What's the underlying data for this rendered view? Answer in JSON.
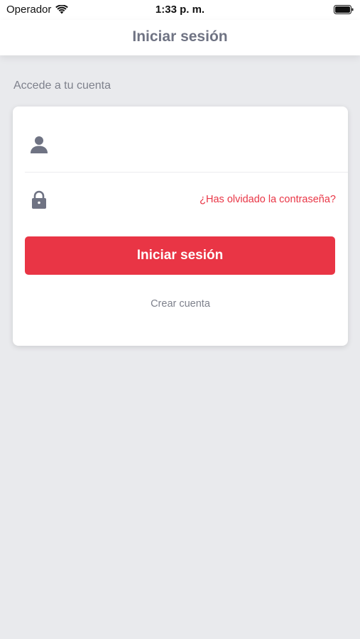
{
  "status_bar": {
    "carrier": "Operador",
    "time": "1:33 p. m."
  },
  "nav": {
    "title": "Iniciar sesión"
  },
  "section_label": "Accede a tu cuenta",
  "form": {
    "username_value": "",
    "username_placeholder": "",
    "password_value": "",
    "password_placeholder": "",
    "forgot_password": "¿Has olvidado la contraseña?",
    "login_button": "Iniciar sesión",
    "create_account": "Crear cuenta"
  },
  "icons": {
    "wifi": "wifi-icon",
    "battery": "battery-icon",
    "user": "user-icon",
    "lock": "lock-icon"
  },
  "colors": {
    "accent": "#e93545",
    "icon_gray": "#6f7383",
    "background": "#e9eaed"
  }
}
